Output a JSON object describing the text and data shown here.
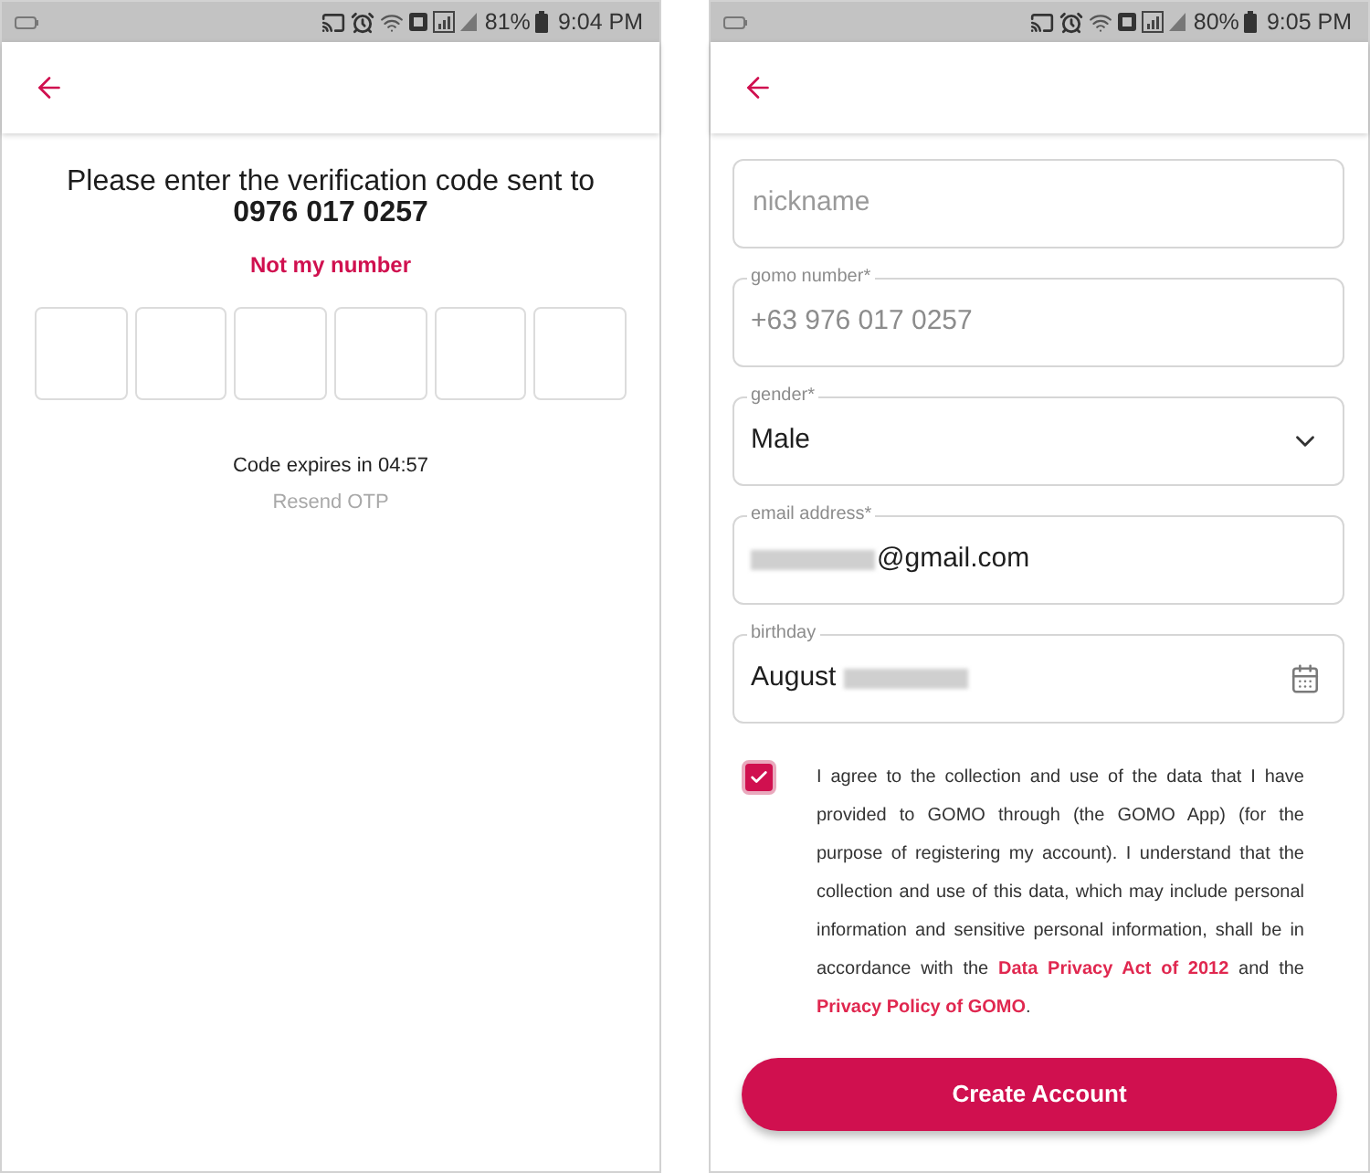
{
  "otp_screen": {
    "status_bar": {
      "battery_percent": "81%",
      "time": "9:04 PM"
    },
    "prompt": "Please enter the verification code sent to",
    "phone_number": "0976 017 0257",
    "change_number_link": "Not my number",
    "code_boxes": [
      {
        "filled": false
      },
      {
        "filled": false
      },
      {
        "filled": false
      },
      {
        "filled": false
      },
      {
        "filled": false
      },
      {
        "filled": false
      }
    ],
    "timer": "Code expires in 04:57",
    "resend_link": {
      "label": "Resend OTP",
      "disabled": true
    }
  },
  "signup_screen": {
    "status_bar": {
      "battery_percent": "80%",
      "time": "9:05 PM"
    },
    "fields": [
      {
        "kind": "text",
        "placeholder": "nickname"
      },
      {
        "kind": "text",
        "label": "gomo number*",
        "value": "+63 976 017 0257",
        "disabled": true
      },
      {
        "kind": "select",
        "label": "gender*",
        "value": "Male",
        "disabled": false
      },
      {
        "kind": "text",
        "label": "email address*",
        "value_parts": [
          {
            "kind": "blurred"
          },
          {
            "kind": "text",
            "text": "@gmail.com"
          }
        ],
        "disabled": false
      },
      {
        "kind": "date",
        "label": "birthday",
        "value_parts": [
          {
            "kind": "text",
            "text": "August"
          },
          {
            "kind": "blurred"
          }
        ],
        "disabled": false
      }
    ],
    "consent": {
      "checked": true,
      "segments": [
        {
          "kind": "text",
          "text": "I agree to the collection and use of the data that I have provided to GOMO through (the GOMO App) (for the purpose of registering my account). I understand that the collection and use of this data, which may include personal information and sensitive personal information, shall be in accordance with the "
        },
        {
          "kind": "link",
          "text": "Data Privacy Act of 2012"
        },
        {
          "kind": "text",
          "text": " and the "
        },
        {
          "kind": "link",
          "text": "Privacy Policy of GOMO"
        },
        {
          "kind": "text",
          "text": "."
        }
      ]
    },
    "submit_button": "Create Account"
  }
}
